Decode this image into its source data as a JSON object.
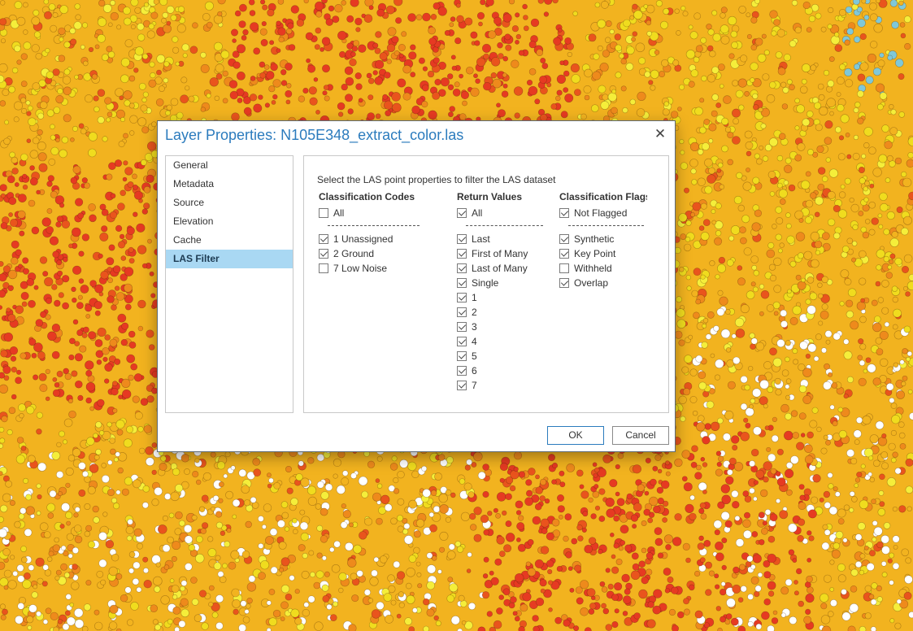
{
  "dialog": {
    "title": "Layer Properties: N105E348_extract_color.las",
    "close_glyph": "✕"
  },
  "nav": {
    "items": [
      {
        "label": "General",
        "active": false
      },
      {
        "label": "Metadata",
        "active": false
      },
      {
        "label": "Source",
        "active": false
      },
      {
        "label": "Elevation",
        "active": false
      },
      {
        "label": "Cache",
        "active": false
      },
      {
        "label": "LAS Filter",
        "active": true
      }
    ]
  },
  "panel": {
    "instruction": "Select the LAS point properties to filter the LAS dataset",
    "classification_codes": {
      "heading": "Classification Codes",
      "all": {
        "label": "All",
        "checked": false
      },
      "items": [
        {
          "label": "1 Unassigned",
          "checked": true
        },
        {
          "label": "2 Ground",
          "checked": true
        },
        {
          "label": "7 Low Noise",
          "checked": false
        }
      ]
    },
    "return_values": {
      "heading": "Return Values",
      "all": {
        "label": "All",
        "checked": true
      },
      "items": [
        {
          "label": "Last",
          "checked": true
        },
        {
          "label": "First of Many",
          "checked": true
        },
        {
          "label": "Last of Many",
          "checked": true
        },
        {
          "label": "Single",
          "checked": true
        },
        {
          "label": "1",
          "checked": true
        },
        {
          "label": "2",
          "checked": true
        },
        {
          "label": "3",
          "checked": true
        },
        {
          "label": "4",
          "checked": true
        },
        {
          "label": "5",
          "checked": true
        },
        {
          "label": "6",
          "checked": true
        },
        {
          "label": "7",
          "checked": true
        }
      ]
    },
    "classification_flags": {
      "heading": "Classification Flags",
      "all": {
        "label": "Not Flagged",
        "checked": true
      },
      "items": [
        {
          "label": "Synthetic",
          "checked": true
        },
        {
          "label": "Key Point",
          "checked": true
        },
        {
          "label": "Withheld",
          "checked": false
        },
        {
          "label": "Overlap",
          "checked": true
        }
      ]
    }
  },
  "buttons": {
    "ok": "OK",
    "cancel": "Cancel"
  },
  "background": {
    "colors": [
      "#f0dc1e",
      "#f2b31f",
      "#ee8a1c",
      "#e9541d",
      "#e63a22",
      "#f5ee3a",
      "#ffffff",
      "#7fc8d8"
    ]
  }
}
